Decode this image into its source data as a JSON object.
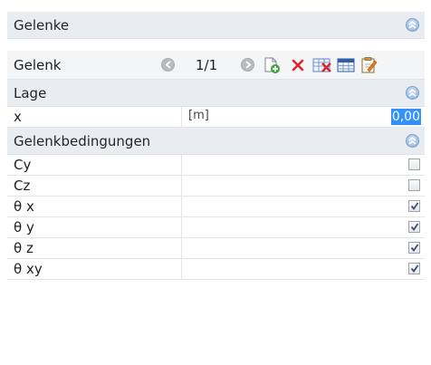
{
  "sections": {
    "gelenke": {
      "title": "Gelenke"
    },
    "lage": {
      "title": "Lage"
    },
    "bedingungen": {
      "title": "Gelenkbedingungen"
    }
  },
  "navigator": {
    "label": "Gelenk",
    "counter": "1/1"
  },
  "lage_rows": [
    {
      "label": "x",
      "unit": "[m]",
      "value": "0,00"
    }
  ],
  "conditions": [
    {
      "label": "Cy",
      "checked": false
    },
    {
      "label": "Cz",
      "checked": false
    },
    {
      "label": "θ x",
      "checked": true
    },
    {
      "label": "θ y",
      "checked": true
    },
    {
      "label": "θ z",
      "checked": true
    },
    {
      "label": "θ xy",
      "checked": true
    }
  ],
  "icons": {
    "collapse": "double-chevron-up-icon",
    "prev": "previous-circle-icon",
    "next": "next-circle-icon",
    "add": "add-item-icon",
    "delete": "delete-x-icon",
    "delete_table": "delete-table-icon",
    "table": "table-icon",
    "edit": "edit-clipboard-icon"
  },
  "colors": {
    "section_header_bg": "#e9edf1",
    "selection_bg": "#3390ff",
    "delete_red": "#d9262b",
    "add_green": "#3aa53a"
  }
}
